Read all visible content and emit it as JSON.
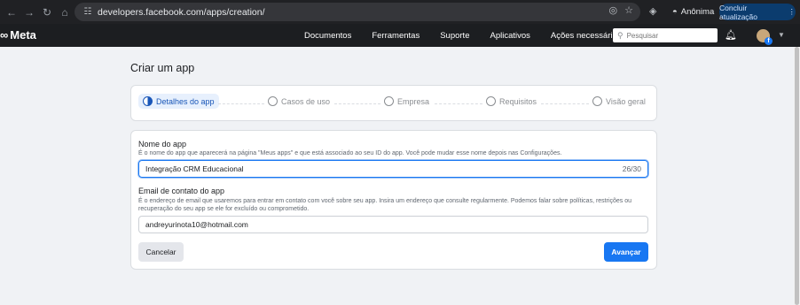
{
  "browser": {
    "url": "developers.facebook.com/apps/creation/",
    "profile_label": "Anônima",
    "update_label": "Concluir atualização"
  },
  "topbar": {
    "logo_text": "Meta",
    "menu": [
      "Documentos",
      "Ferramentas",
      "Suporte",
      "Aplicativos",
      "Ações necessárias"
    ],
    "search_placeholder": "Pesquisar"
  },
  "page": {
    "title": "Criar um app"
  },
  "steps": [
    {
      "label": "Detalhes do app",
      "active": true
    },
    {
      "label": "Casos de uso",
      "active": false
    },
    {
      "label": "Empresa",
      "active": false
    },
    {
      "label": "Requisitos",
      "active": false
    },
    {
      "label": "Visão geral",
      "active": false
    }
  ],
  "form": {
    "app_name_label": "Nome do app",
    "app_name_help": "É o nome do app que aparecerá na página \"Meus apps\" e que está associado ao seu ID do app. Você pode mudar esse nome depois nas Configurações.",
    "app_name_value": "Integração CRM Educacional",
    "app_name_count": "26/30",
    "email_label": "Email de contato do app",
    "email_help": "É o endereço de email que usaremos para entrar em contato com você sobre seu app. Insira um endereço que consulte regularmente. Podemos falar sobre políticas, restrições ou recuperação do seu app se ele for excluído ou comprometido.",
    "email_value": "andreyurinota10@hotmail.com",
    "cancel_label": "Cancelar",
    "next_label": "Avançar"
  },
  "colors": {
    "primary": "#1877f2",
    "topbar": "#1c1e21",
    "background": "#f0f2f5"
  }
}
